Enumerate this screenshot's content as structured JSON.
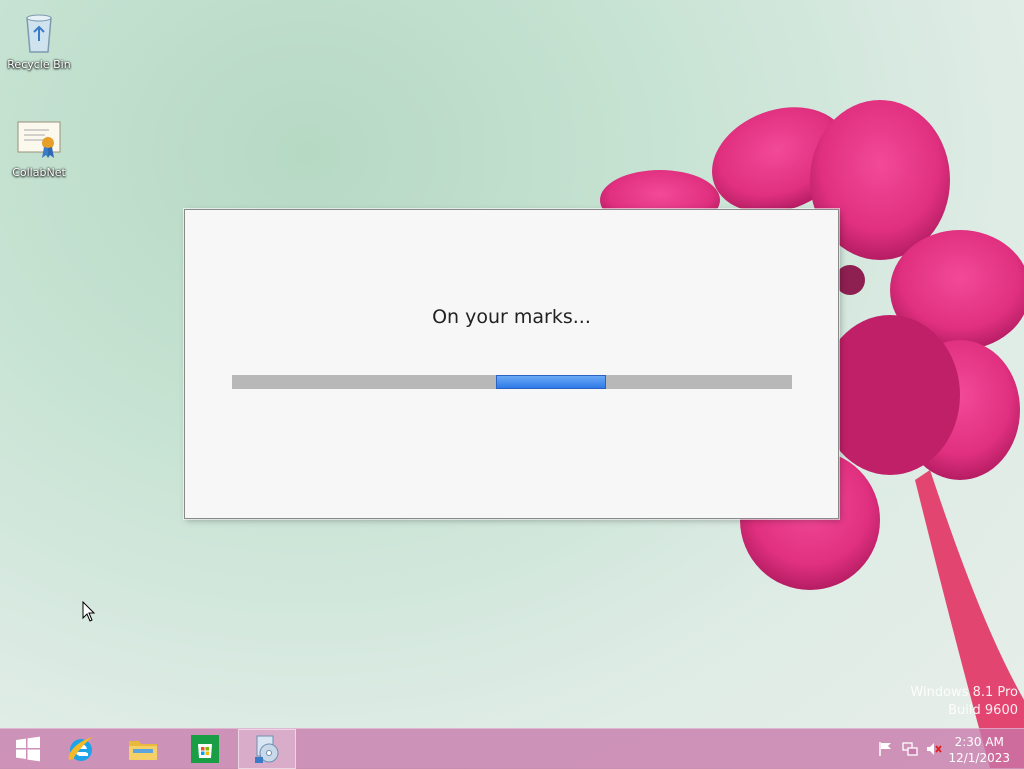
{
  "desktop": {
    "icons": [
      {
        "label": "Recycle Bin",
        "icon": "recycle-bin-icon"
      },
      {
        "label": "CollabNet",
        "icon": "certificate-icon"
      }
    ]
  },
  "dialog": {
    "message": "On your marks...",
    "progress": {
      "style": "marquee",
      "color": "#3a86ee"
    }
  },
  "watermark": {
    "line1": "Windows 8.1 Pro",
    "line2": "Build 9600"
  },
  "taskbar": {
    "buttons": [
      {
        "name": "start",
        "icon": "windows-logo-icon"
      },
      {
        "name": "internet-explorer",
        "icon": "internet-explorer-icon"
      },
      {
        "name": "file-explorer",
        "icon": "folder-icon"
      },
      {
        "name": "store",
        "icon": "store-icon"
      },
      {
        "name": "installer",
        "icon": "setup-disc-icon",
        "active": true
      }
    ],
    "tray": {
      "icons": [
        "flag-icon",
        "network-icon",
        "speaker-muted-icon"
      ],
      "time": "2:30 AM",
      "date": "12/1/2023"
    },
    "color": "#c87aaa"
  }
}
